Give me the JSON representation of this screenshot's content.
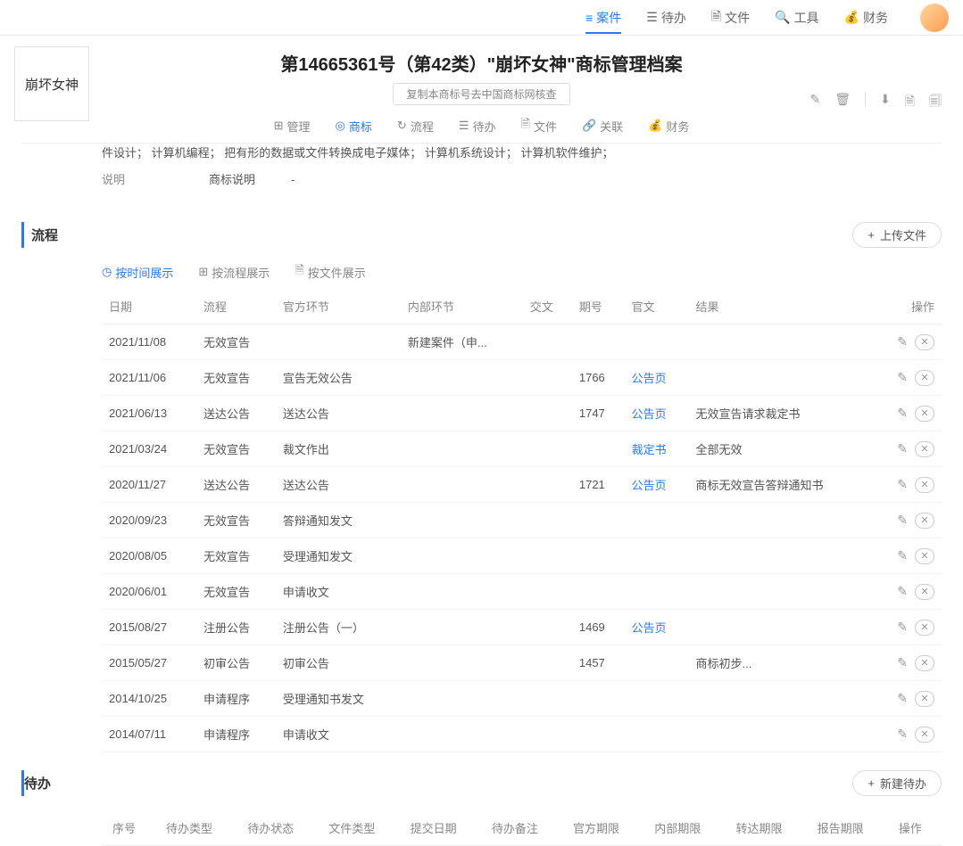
{
  "topnav": {
    "items": [
      {
        "label": "案件",
        "icon": "layers",
        "active": true
      },
      {
        "label": "待办",
        "icon": "inbox"
      },
      {
        "label": "文件",
        "icon": "file"
      },
      {
        "label": "工具",
        "icon": "search"
      },
      {
        "label": "财务",
        "icon": "bag"
      }
    ]
  },
  "header": {
    "brand": "崩坏女神",
    "title": "第14665361号（第42类）\"崩坏女神\"商标管理档案",
    "subtitle": "复制本商标号去中国商标网核查",
    "tabs": [
      {
        "label": "管理",
        "icon": "grid"
      },
      {
        "label": "商标",
        "icon": "target",
        "active": true
      },
      {
        "label": "流程",
        "icon": "refresh"
      },
      {
        "label": "待办",
        "icon": "inbox"
      },
      {
        "label": "文件",
        "icon": "file"
      },
      {
        "label": "关联",
        "icon": "link"
      },
      {
        "label": "财务",
        "icon": "bag"
      }
    ]
  },
  "desc": {
    "text": "件设计； 计算机编程； 把有形的数据或文件转换成电子媒体； 计算机系统设计； 计算机软件维护；",
    "label": "说明",
    "value_label": "商标说明",
    "value": "-"
  },
  "flow": {
    "title": "流程",
    "upload_btn": "上传文件",
    "subtabs": [
      {
        "label": "按时间展示",
        "icon": "clock",
        "active": true
      },
      {
        "label": "按流程展示",
        "icon": "grid4"
      },
      {
        "label": "按文件展示",
        "icon": "doc"
      }
    ],
    "columns": [
      "日期",
      "流程",
      "官方环节",
      "内部环节",
      "交文",
      "期号",
      "官文",
      "结果",
      "操作"
    ],
    "rows": [
      {
        "date": "2021/11/08",
        "flow": "无效宣告",
        "official": "",
        "internal": "新建案件（申...",
        "deliver": "",
        "issue": "",
        "doc": "",
        "result": ""
      },
      {
        "date": "2021/11/06",
        "flow": "无效宣告",
        "official": "宣告无效公告",
        "internal": "",
        "deliver": "",
        "issue": "1766",
        "doc": "公告页",
        "result": ""
      },
      {
        "date": "2021/06/13",
        "flow": "送达公告",
        "official": "送达公告",
        "internal": "",
        "deliver": "",
        "issue": "1747",
        "doc": "公告页",
        "result": "无效宣告请求裁定书"
      },
      {
        "date": "2021/03/24",
        "flow": "无效宣告",
        "official": "裁文作出",
        "internal": "",
        "deliver": "",
        "issue": "",
        "doc": "裁定书",
        "result": "全部无效"
      },
      {
        "date": "2020/11/27",
        "flow": "送达公告",
        "official": "送达公告",
        "internal": "",
        "deliver": "",
        "issue": "1721",
        "doc": "公告页",
        "result": "商标无效宣告答辩通知书"
      },
      {
        "date": "2020/09/23",
        "flow": "无效宣告",
        "official": "答辩通知发文",
        "internal": "",
        "deliver": "",
        "issue": "",
        "doc": "",
        "result": ""
      },
      {
        "date": "2020/08/05",
        "flow": "无效宣告",
        "official": "受理通知发文",
        "internal": "",
        "deliver": "",
        "issue": "",
        "doc": "",
        "result": ""
      },
      {
        "date": "2020/06/01",
        "flow": "无效宣告",
        "official": "申请收文",
        "internal": "",
        "deliver": "",
        "issue": "",
        "doc": "",
        "result": ""
      },
      {
        "date": "2015/08/27",
        "flow": "注册公告",
        "official": "注册公告（一）",
        "internal": "",
        "deliver": "",
        "issue": "1469",
        "doc": "公告页",
        "result": ""
      },
      {
        "date": "2015/05/27",
        "flow": "初审公告",
        "official": "初审公告",
        "internal": "",
        "deliver": "",
        "issue": "1457",
        "doc": "",
        "result": "商标初步..."
      },
      {
        "date": "2014/10/25",
        "flow": "申请程序",
        "official": "受理通知书发文",
        "internal": "",
        "deliver": "",
        "issue": "",
        "doc": "",
        "result": ""
      },
      {
        "date": "2014/07/11",
        "flow": "申请程序",
        "official": "申请收文",
        "internal": "",
        "deliver": "",
        "issue": "",
        "doc": "",
        "result": ""
      }
    ]
  },
  "todo": {
    "title": "待办",
    "new_btn": "新建待办",
    "columns": [
      "序号",
      "待办类型",
      "待办状态",
      "文件类型",
      "提交日期",
      "待办备注",
      "官方期限",
      "内部期限",
      "转达期限",
      "报告期限",
      "操作"
    ]
  }
}
